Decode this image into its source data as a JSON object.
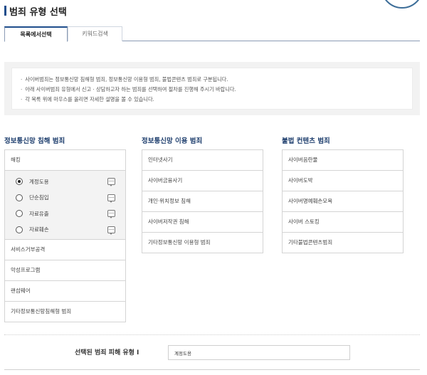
{
  "page": {
    "title": "범죄 유형 선택"
  },
  "tabs": [
    {
      "label": "목록에서선택",
      "active": true
    },
    {
      "label": "키워드검색",
      "active": false
    }
  ],
  "notice": {
    "lines": [
      "사이버범죄는 정보통신망 침해형 범죄, 정보통신망 이용형 범죄, 불법콘텐츠 범죄로 구분됩니다.",
      "아래 사이버범죄 유형에서 신고 · 상담하고자 하는 범죄를 선택하여 절차를 진행해 주시기 바랍니다.",
      "각 목록 위에 마우스를 올리면 자세한 설명을 볼 수 있습니다."
    ]
  },
  "columns": {
    "intrusion": {
      "title": "정보통신망 침해 범죄",
      "hacking": "해킹",
      "sub_items": [
        {
          "label": "계정도용",
          "selected": true
        },
        {
          "label": "단순침입",
          "selected": false
        },
        {
          "label": "자료유출",
          "selected": false
        },
        {
          "label": "자료훼손",
          "selected": false
        }
      ],
      "items": [
        "서비스거부공격",
        "악성프로그램",
        "랜섬웨어",
        "기타정보통신망침해형 범죄"
      ]
    },
    "usage": {
      "title": "정보통신망 이용 범죄",
      "items": [
        "인터넷사기",
        "사이버금융사기",
        "개인·위치정보 침해",
        "사이버저작권 침해",
        "기타정보통신망 이용형 범죄"
      ]
    },
    "illegal": {
      "title": "불법 컨텐츠 범죄",
      "items": [
        "사이버음란물",
        "사이버도박",
        "사이버명예훼손모욕",
        "사이버 스토킹",
        "기타불법콘텐츠범죄"
      ]
    }
  },
  "selected": {
    "label": "선택된 범죄 피해 유형 I",
    "value": "계정도용"
  },
  "icons": {
    "tooltip": "chat-bubble-icon"
  },
  "colors": {
    "accent": "#1f4e8c",
    "heading": "#1f3f6e",
    "border": "#d4d4d4",
    "subBg": "#f3f3f3"
  }
}
